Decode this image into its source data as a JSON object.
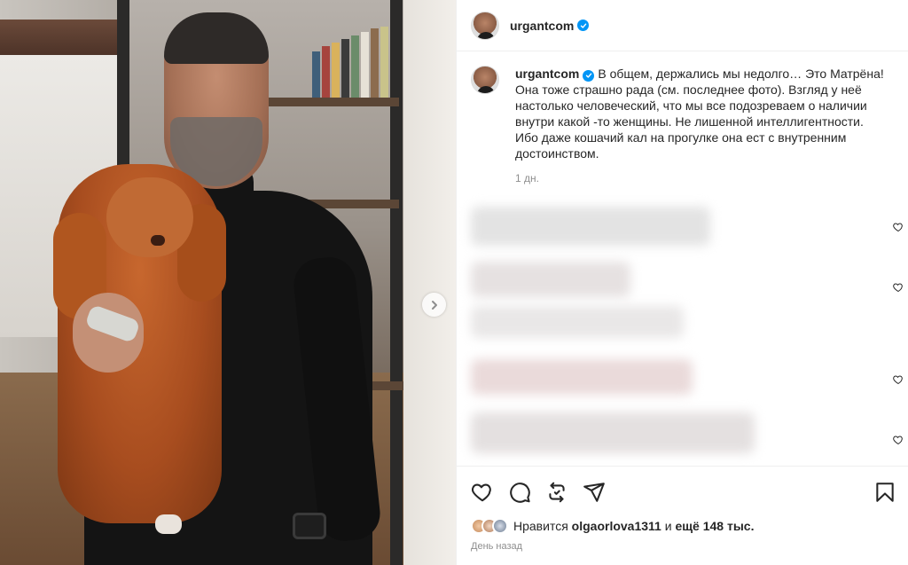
{
  "post": {
    "username": "urgantcom",
    "caption_text": "В общем, держались мы недолго… Это Матрёна! Она тоже страшно рада (см. последнее фото). Взгляд у неё настолько человеческий, что мы все подозреваем о наличии внутри какой -то женщины. Не лишенной интеллигентности. Ибо даже кошачий кал на прогулке она ест с внутренним достоинством.",
    "caption_time": "1 дн.",
    "verified": true
  },
  "likes": {
    "prefix": "Нравится",
    "user": "olgaorlova1311",
    "connector": "и",
    "count": "ещё 148 тыс."
  },
  "date": "День назад",
  "icons": {
    "verified": "verified-check-icon",
    "next": "chevron-right-icon",
    "like": "heart-icon",
    "comment": "comment-bubble-icon",
    "share": "repost-icon",
    "send": "paper-plane-icon",
    "save": "bookmark-icon"
  },
  "colors": {
    "verified_blue": "#0095f6",
    "text": "#262626",
    "secondary_text": "#8e8e8e"
  }
}
